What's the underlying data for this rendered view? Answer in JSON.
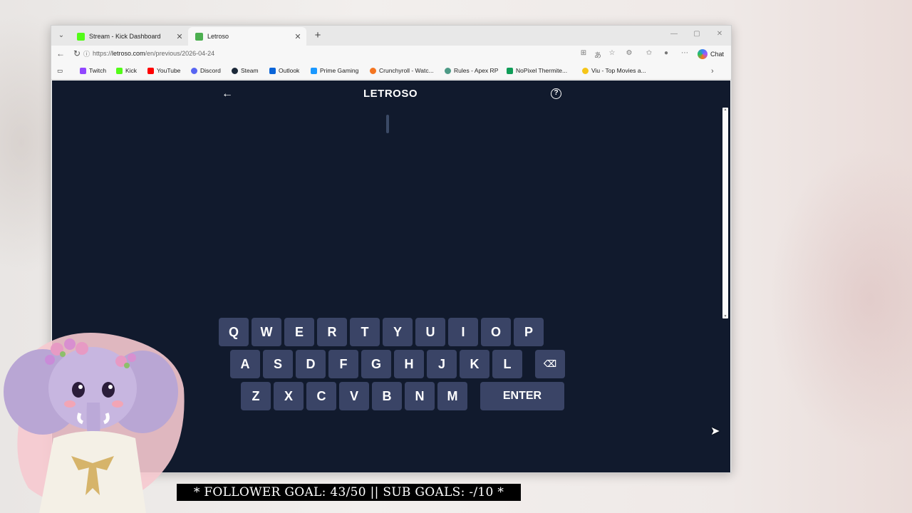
{
  "browser": {
    "tabs": [
      {
        "title": "Stream - Kick Dashboard",
        "active": false,
        "favicon_color": "#53fc18"
      },
      {
        "title": "Letroso",
        "active": true,
        "favicon_color": "#4caf50"
      }
    ],
    "url_prefix": "https://",
    "url_domain": "letroso.com",
    "url_path": "/en/previous/2026-04-24",
    "chat_label": "Chat",
    "bookmarks": [
      {
        "label": "Twitch",
        "color": "#9146ff"
      },
      {
        "label": "Kick",
        "color": "#53fc18"
      },
      {
        "label": "YouTube",
        "color": "#ff0000"
      },
      {
        "label": "Discord",
        "color": "#5865f2"
      },
      {
        "label": "Steam",
        "color": "#1b2838"
      },
      {
        "label": "Outlook",
        "color": "#0a64d8"
      },
      {
        "label": "Prime Gaming",
        "color": "#1a98ff"
      },
      {
        "label": "Crunchyroll - Watc...",
        "color": "#f47521"
      },
      {
        "label": "Rules - Apex RP",
        "color": "#4d9a86"
      },
      {
        "label": "NoPixel Thermite...",
        "color": "#0f9d58"
      },
      {
        "label": "Viu - Top Movies a...",
        "color": "#f5c518"
      }
    ]
  },
  "game": {
    "title": "LETROSO",
    "keyboard": {
      "row1": [
        "Q",
        "W",
        "E",
        "R",
        "T",
        "Y",
        "U",
        "I",
        "O",
        "P"
      ],
      "row2": [
        "A",
        "S",
        "D",
        "F",
        "G",
        "H",
        "J",
        "K",
        "L"
      ],
      "row3": [
        "Z",
        "X",
        "C",
        "V",
        "B",
        "N",
        "M"
      ],
      "enter_label": "ENTER",
      "backspace_icon": "backspace-icon"
    }
  },
  "overlay": {
    "goal_text": "* FOLLOWER GOAL: 43/50 || SUB GOALS: -/10 *"
  },
  "colors": {
    "page_bg": "#111a2d",
    "key_bg": "#3a4466"
  }
}
